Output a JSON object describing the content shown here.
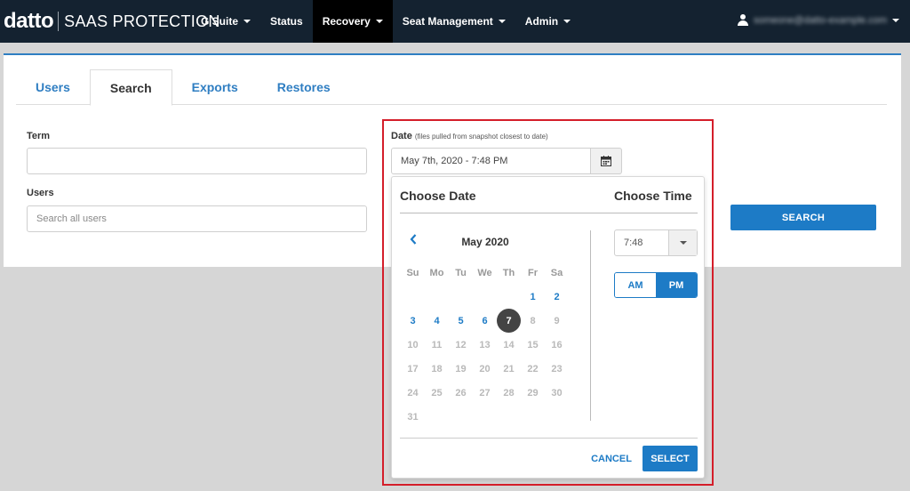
{
  "brand": {
    "logo": "datto",
    "product": "SAAS PROTECTION"
  },
  "nav": {
    "items": [
      {
        "label": "G Suite",
        "dropdown": true
      },
      {
        "label": "Status",
        "dropdown": false
      },
      {
        "label": "Recovery",
        "dropdown": true,
        "active": true
      },
      {
        "label": "Seat Management",
        "dropdown": true
      },
      {
        "label": "Admin",
        "dropdown": true
      }
    ],
    "user_email": "someone@datto-example.com"
  },
  "tabs": [
    {
      "label": "Users"
    },
    {
      "label": "Search",
      "active": true
    },
    {
      "label": "Exports"
    },
    {
      "label": "Restores"
    }
  ],
  "form": {
    "term_label": "Term",
    "term_value": "",
    "users_label": "Users",
    "users_placeholder": "Search all users",
    "date_label": "Date",
    "date_hint": "(files pulled from snapshot closest to date)",
    "date_value": "May 7th, 2020 - 7:48 PM",
    "search_button": "SEARCH"
  },
  "picker": {
    "choose_date": "Choose Date",
    "choose_time": "Choose Time",
    "month_title": "May 2020",
    "weekdays": [
      "Su",
      "Mo",
      "Tu",
      "We",
      "Th",
      "Fr",
      "Sa"
    ],
    "weeks": [
      [
        "",
        "",
        "",
        "",
        "",
        "1",
        "2"
      ],
      [
        "3",
        "4",
        "5",
        "6",
        "7",
        "8",
        "9"
      ],
      [
        "10",
        "11",
        "12",
        "13",
        "14",
        "15",
        "16"
      ],
      [
        "17",
        "18",
        "19",
        "20",
        "21",
        "22",
        "23"
      ],
      [
        "24",
        "25",
        "26",
        "27",
        "28",
        "29",
        "30"
      ],
      [
        "31",
        "",
        "",
        "",
        "",
        "",
        ""
      ]
    ],
    "available_days": [
      "1",
      "2",
      "3",
      "4",
      "5",
      "6",
      "7"
    ],
    "selected_day": "7",
    "time_value": "7:48",
    "am_label": "AM",
    "pm_label": "PM",
    "meridiem_selected": "PM",
    "cancel": "CANCEL",
    "select": "SELECT"
  },
  "colors": {
    "nav_bg": "#142230",
    "accent": "#1d7bc6",
    "highlight": "#d41e2a",
    "selected_day": "#444444"
  }
}
